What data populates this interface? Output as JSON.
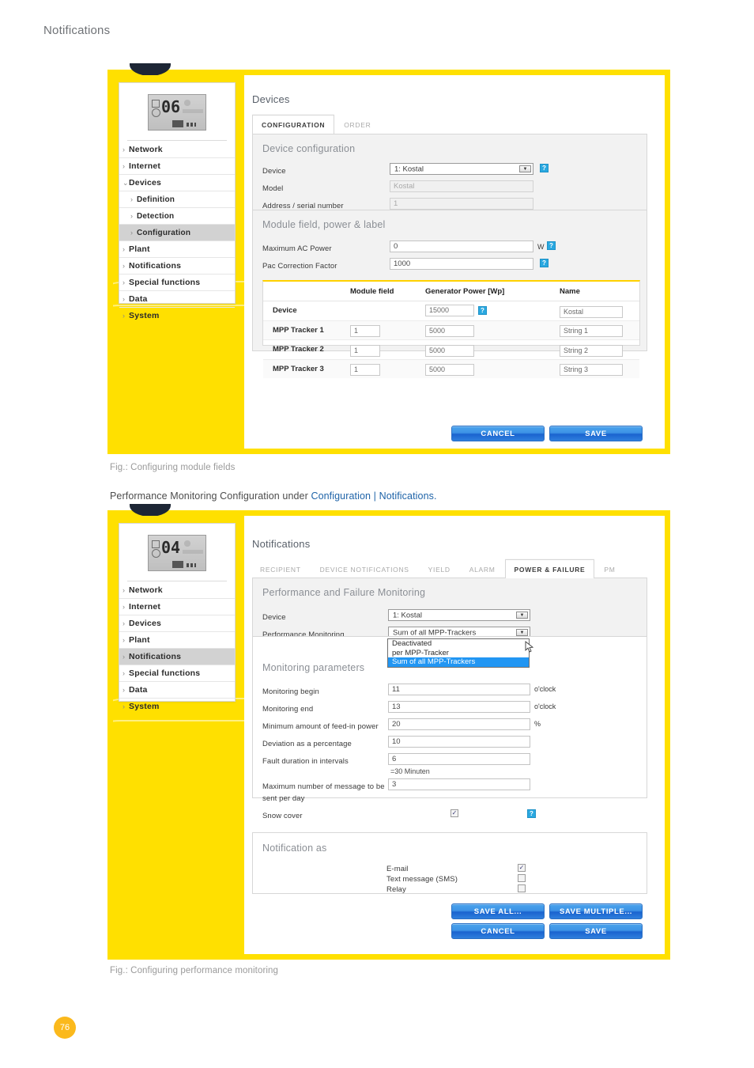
{
  "page": {
    "header": "Notifications",
    "number": "76"
  },
  "fig1": {
    "caption": "Fig.: Configuring module fields",
    "lcd": "06",
    "nav": [
      {
        "label": "Network",
        "level": 0,
        "active": false
      },
      {
        "label": "Internet",
        "level": 0,
        "active": false
      },
      {
        "label": "Devices",
        "level": 0,
        "active": false,
        "expanded": true
      },
      {
        "label": "Definition",
        "level": 1,
        "active": false
      },
      {
        "label": "Detection",
        "level": 1,
        "active": false
      },
      {
        "label": "Configuration",
        "level": 1,
        "active": true
      },
      {
        "label": "Plant",
        "level": 0,
        "active": false
      },
      {
        "label": "Notifications",
        "level": 0,
        "active": false
      },
      {
        "label": "Special functions",
        "level": 0,
        "active": false
      },
      {
        "label": "Data",
        "level": 0,
        "active": false
      },
      {
        "label": "System",
        "level": 0,
        "active": false
      }
    ],
    "title": "Devices",
    "tabs": [
      {
        "label": "CONFIGURATION",
        "active": true
      },
      {
        "label": "ORDER",
        "active": false
      }
    ],
    "device_config": {
      "section_title": "Device configuration",
      "device_label": "Device",
      "device_value": "1: Kostal",
      "model_label": "Model",
      "model_value": "Kostal",
      "address_label": "Address / serial number",
      "address_value": "1",
      "help": "?"
    },
    "module_field": {
      "section_title": "Module field, power & label",
      "max_ac_label": "Maximum AC Power",
      "max_ac_value": "0",
      "max_ac_unit": "W",
      "pac_label": "Pac Correction Factor",
      "pac_value": "1000",
      "help": "?"
    },
    "table": {
      "headers": [
        "",
        "Module field",
        "Generator Power [Wp]",
        "Name"
      ],
      "rows": [
        {
          "label": "Device",
          "module_field": "",
          "power": "15000",
          "name": "Kostal",
          "has_help": true
        },
        {
          "label": "MPP Tracker 1",
          "module_field": "1",
          "power": "5000",
          "name": "String 1",
          "has_help": false
        },
        {
          "label": "MPP Tracker 2",
          "module_field": "1",
          "power": "5000",
          "name": "String 2",
          "has_help": false
        },
        {
          "label": "MPP Tracker 3",
          "module_field": "1",
          "power": "5000",
          "name": "String 3",
          "has_help": false
        }
      ]
    },
    "buttons": [
      {
        "label": "CANCEL"
      },
      {
        "label": "SAVE"
      }
    ]
  },
  "intro_text": {
    "prefix": "Performance Monitoring Configuration under ",
    "accent": "Configuration | Notifications.",
    "full": "Performance Monitoring Configuration under Configuration | Notifications."
  },
  "fig2": {
    "caption": "Fig.: Configuring performance monitoring",
    "lcd": "04",
    "nav": [
      {
        "label": "Network",
        "level": 0,
        "active": false
      },
      {
        "label": "Internet",
        "level": 0,
        "active": false
      },
      {
        "label": "Devices",
        "level": 0,
        "active": false
      },
      {
        "label": "Plant",
        "level": 0,
        "active": false
      },
      {
        "label": "Notifications",
        "level": 0,
        "active": true
      },
      {
        "label": "Special functions",
        "level": 0,
        "active": false
      },
      {
        "label": "Data",
        "level": 0,
        "active": false
      },
      {
        "label": "System",
        "level": 0,
        "active": false
      }
    ],
    "title": "Notifications",
    "tabs": [
      {
        "label": "RECIPIENT",
        "active": false
      },
      {
        "label": "DEVICE NOTIFICATIONS",
        "active": false
      },
      {
        "label": "YIELD",
        "active": false
      },
      {
        "label": "ALARM",
        "active": false
      },
      {
        "label": "POWER & FAILURE",
        "active": true
      },
      {
        "label": "PM",
        "active": false
      }
    ],
    "perf": {
      "section_title": "Performance and Failure Monitoring",
      "device_label": "Device",
      "device_value": "1: Kostal",
      "monitoring_label": "Performance Monitoring",
      "monitoring_value": "Sum of all MPP-Trackers",
      "options": [
        {
          "label": "Deactivated",
          "selected": false
        },
        {
          "label": "per MPP-Tracker",
          "selected": false
        },
        {
          "label": "Sum of all MPP-Trackers",
          "selected": true
        }
      ]
    },
    "params": {
      "section_title": "Monitoring parameters",
      "rows": [
        {
          "label": "Monitoring begin",
          "value": "11",
          "unit": "o'clock"
        },
        {
          "label": "Monitoring end",
          "value": "13",
          "unit": "o'clock"
        },
        {
          "label": "Minimum amount of feed-in power",
          "value": "20",
          "unit": "%"
        },
        {
          "label": "Deviation as a percentage",
          "value": "10",
          "unit": ""
        },
        {
          "label": "Fault duration in intervals",
          "value": "6",
          "unit": ""
        }
      ],
      "interval_note": "=30 Minuten",
      "max_msg_label_1": "Maximum number of message to be",
      "max_msg_label_2": "sent per day",
      "max_msg_value": "3",
      "snow_label": "Snow cover",
      "snow_checked": true,
      "help": "?"
    },
    "notification_as": {
      "section_title": "Notification as",
      "options": [
        {
          "label": "E-mail",
          "checked": true
        },
        {
          "label": "Text message (SMS)",
          "checked": false
        },
        {
          "label": "Relay",
          "checked": false
        }
      ]
    },
    "buttons": [
      {
        "label": "SAVE ALL..."
      },
      {
        "label": "SAVE MULTIPLE..."
      },
      {
        "label": "CANCEL"
      },
      {
        "label": "SAVE"
      }
    ]
  },
  "colors": {
    "yellow": "#ffe000",
    "accent_blue": "#1e63a8",
    "button_blue": "#2f7fdd",
    "help_blue": "#2aa8e0",
    "page_badge": "#fbb91c"
  }
}
